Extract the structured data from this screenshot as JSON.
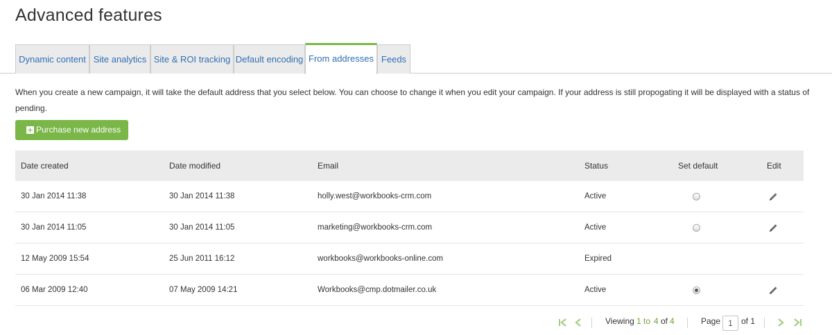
{
  "page": {
    "title": "Advanced features"
  },
  "tabs": [
    {
      "label": "Dynamic content",
      "active": false
    },
    {
      "label": "Site analytics",
      "active": false
    },
    {
      "label": "Site & ROI tracking",
      "active": false
    },
    {
      "label": "Default encoding",
      "active": false
    },
    {
      "label": "From addresses",
      "active": true
    },
    {
      "label": "Feeds",
      "active": false
    }
  ],
  "intro": {
    "text": "When you create a new campaign, it will take the default address that you select below. You can choose to change it when you edit your campaign. If your address is still propogating it will be displayed with a status of pending."
  },
  "purchase_button": {
    "label": "Purchase new address",
    "icon": "plus-square-icon"
  },
  "table": {
    "headers": {
      "date_created": "Date created",
      "date_modified": "Date modified",
      "email": "Email",
      "status": "Status",
      "set_default": "Set default",
      "edit": "Edit"
    },
    "rows": [
      {
        "date_created": "30 Jan 2014 11:38",
        "date_modified": "30 Jan 2014 11:38",
        "email": "holly.west@workbooks-crm.com",
        "status": "Active",
        "is_default": false,
        "can_edit": true
      },
      {
        "date_created": "30 Jan 2014 11:05",
        "date_modified": "30 Jan 2014 11:05",
        "email": "marketing@workbooks-crm.com",
        "status": "Active",
        "is_default": false,
        "can_edit": true
      },
      {
        "date_created": "12 May 2009 15:54",
        "date_modified": "25 Jun 2011 16:12",
        "email": "workbooks@workbooks-online.com",
        "status": "Expired",
        "is_default": null,
        "can_edit": false
      },
      {
        "date_created": "06 Mar 2009 12:40",
        "date_modified": "07 May 2009 14:21",
        "email": "Workbooks@cmp.dotmailer.co.uk",
        "status": "Active",
        "is_default": true,
        "can_edit": true
      }
    ]
  },
  "pager": {
    "viewing_prefix": "Viewing",
    "range_start": "1",
    "range_to": "to",
    "range_end": "4",
    "of_word": "of",
    "total": "4",
    "page_label": "Page",
    "page_value": "1",
    "page_of": "of 1"
  },
  "colors": {
    "accent_green": "#7ab648",
    "link_blue": "#2f6fb4",
    "header_bg": "#ebebeb"
  }
}
